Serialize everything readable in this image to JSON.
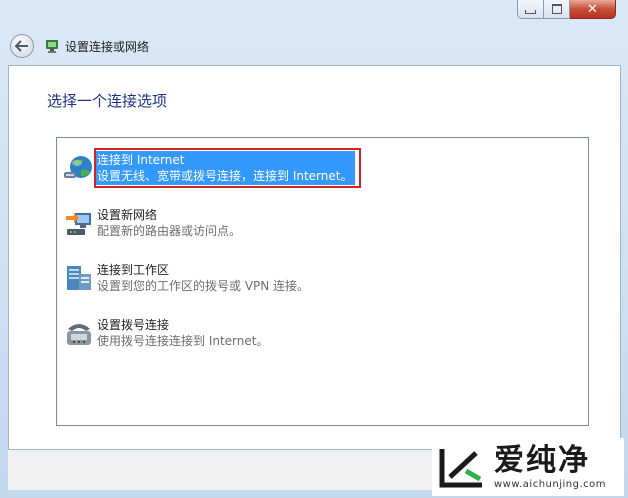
{
  "window": {
    "title": "设置连接或网络",
    "caption_close_glyph": "✕"
  },
  "main": {
    "heading": "选择一个连接选项",
    "options": [
      {
        "title": "连接到 Internet",
        "description": "设置无线、宽带或拨号连接，连接到 Internet。",
        "icon": "globe-network-icon",
        "selected": true
      },
      {
        "title": "设置新网络",
        "description": "配置新的路由器或访问点。",
        "icon": "router-setup-icon",
        "selected": false
      },
      {
        "title": "连接到工作区",
        "description": "设置到您的工作区的拨号或 VPN 连接。",
        "icon": "workplace-server-icon",
        "selected": false
      },
      {
        "title": "设置拨号连接",
        "description": "使用拨号连接连接到 Internet。",
        "icon": "dialup-phone-icon",
        "selected": false
      }
    ]
  },
  "watermark": {
    "name": "爱纯净",
    "url": "www.aichunjing.com"
  },
  "colors": {
    "selection": "#3399ff",
    "highlight_border": "#d42127",
    "heading": "#1e3287"
  }
}
